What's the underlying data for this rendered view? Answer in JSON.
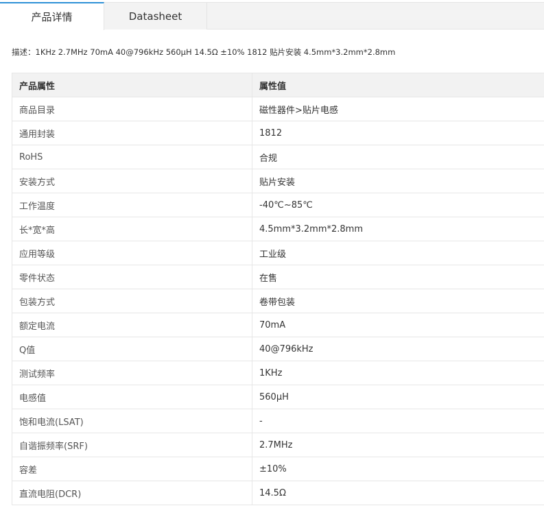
{
  "tabs": [
    {
      "label": "产品详情",
      "active": true
    },
    {
      "label": "Datasheet",
      "active": false
    }
  ],
  "description": "描述：1KHz 2.7MHz 70mA 40@796kHz 560μH 14.5Ω ±10% 1812 贴片安装 4.5mm*3.2mm*2.8mm",
  "table": {
    "headers": [
      "产品属性",
      "属性值"
    ],
    "rows": [
      {
        "name": "商品目录",
        "value": "磁性器件>贴片电感"
      },
      {
        "name": "通用封装",
        "value": "1812"
      },
      {
        "name": "RoHS",
        "value": "合规"
      },
      {
        "name": "安装方式",
        "value": "贴片安装"
      },
      {
        "name": "工作温度",
        "value": "-40℃~85℃"
      },
      {
        "name": "长*宽*高",
        "value": "4.5mm*3.2mm*2.8mm"
      },
      {
        "name": "应用等级",
        "value": "工业级"
      },
      {
        "name": "零件状态",
        "value": "在售"
      },
      {
        "name": "包装方式",
        "value": "卷带包装"
      },
      {
        "name": "额定电流",
        "value": "70mA"
      },
      {
        "name": "Q值",
        "value": "40@796kHz"
      },
      {
        "name": "测试频率",
        "value": "1KHz"
      },
      {
        "name": "电感值",
        "value": "560μH"
      },
      {
        "name": "饱和电流(LSAT)",
        "value": "-"
      },
      {
        "name": "自谐振频率(SRF)",
        "value": "2.7MHz"
      },
      {
        "name": "容差",
        "value": "±10%"
      },
      {
        "name": "直流电阻(DCR)",
        "value": "14.5Ω"
      }
    ]
  },
  "colors": {
    "active_tab_accent": "#2c8fd6",
    "header_bg": "#f2f2f2",
    "border": "#e6e6e6"
  }
}
